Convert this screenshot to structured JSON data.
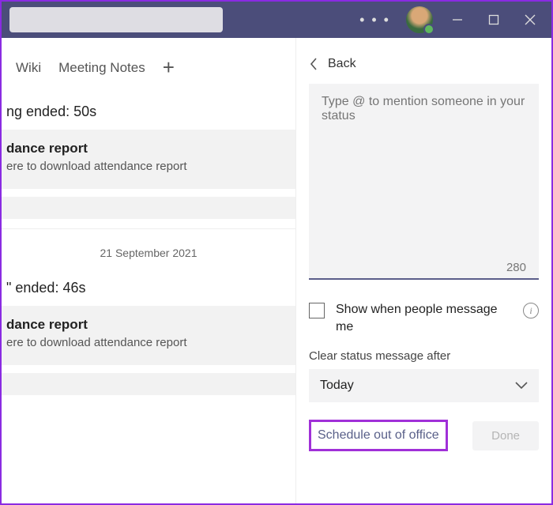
{
  "titlebar": {
    "search_placeholder": ""
  },
  "tabs": {
    "wiki": "Wiki",
    "meeting_notes": "Meeting Notes"
  },
  "feed": {
    "item1_title": "ng ended: 50s",
    "card1_title": "dance report",
    "card1_sub": "ere to download attendance report",
    "date_divider": "21 September 2021",
    "item2_title": "\" ended: 46s",
    "card2_title": "dance report",
    "card2_sub": "ere to download attendance report"
  },
  "panel": {
    "back_label": "Back",
    "status_placeholder": "Type @ to mention someone in your status",
    "char_count": "280",
    "show_label": "Show when people message me",
    "clear_label": "Clear status message after",
    "dropdown_value": "Today",
    "schedule_label": "Schedule out of office",
    "done_label": "Done"
  }
}
